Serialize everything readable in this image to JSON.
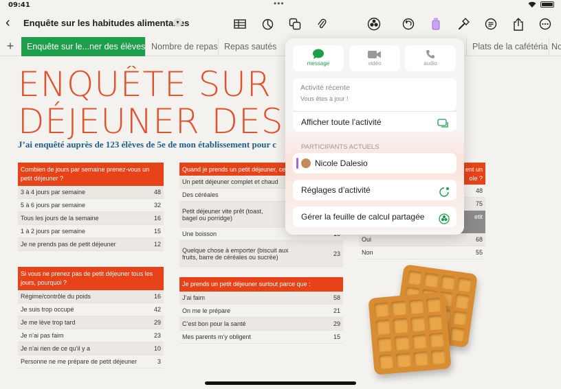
{
  "status": {
    "time": "09:41"
  },
  "toolbar": {
    "title": "Enquête sur les habitudes alimentaires"
  },
  "tabs": [
    "Enquête sur le...ner des élèves",
    "Nombre de repas",
    "Repas sautés",
    "Plats de la cafétéria",
    "No"
  ],
  "sheet": {
    "title_line1": "ENQUÊTE SUR LE",
    "title_line2": "DÉJEUNER DES ÉL",
    "subtitle": "J’ai enquêté auprès de 123 élèves de 5e de mon établissement pour c"
  },
  "tables": {
    "t1": {
      "header": "Combien de jours par semaine prenez-vous un petit déjeuner ?",
      "rows": [
        [
          "3 à 4 jours par semaine",
          "48"
        ],
        [
          "5 à 6 jours par semaine",
          "32"
        ],
        [
          "Tous les jours de la semaine",
          "16"
        ],
        [
          "1 à 2 jours par semaine",
          "15"
        ],
        [
          "Je ne prends pas de petit déjeuner",
          "12"
        ]
      ]
    },
    "t2": {
      "header": "Si vous ne prenez pas de petit déjeuner tous les jours, pourquoi ?",
      "rows": [
        [
          "Régime/contrôle du poids",
          "16"
        ],
        [
          "Je suis trop occupé",
          "42"
        ],
        [
          "Je me lève trop tard",
          "29"
        ],
        [
          "Je n’ai pas faim",
          "23"
        ],
        [
          "Je n’ai rien de ce qu’il y a",
          "10"
        ],
        [
          "Personne ne me prépare de petit déjeuner",
          "3"
        ]
      ]
    },
    "t3": {
      "header": "Quand je prends un petit déjeuner, ce que",
      "rows": [
        [
          "Un petit déjeuner complet et chaud",
          ""
        ],
        [
          "Des céréales",
          ""
        ],
        [
          "Petit déjeuner vite prêt (toast, bagel ou porridge)",
          ""
        ],
        [
          "Une boisson",
          "18"
        ],
        [
          "Quelque chose à emporter (biscuit aux fruits, barre de céréales ou sucrée)",
          "23"
        ]
      ]
    },
    "t4": {
      "header": "Je prends un petit déjeuner surtout parce que :",
      "rows": [
        [
          "J’ai faim",
          "58"
        ],
        [
          "On me le prépare",
          "21"
        ],
        [
          "C’est bon pour la santé",
          "29"
        ],
        [
          "Mes parents m’y obligent",
          "15"
        ]
      ]
    },
    "t5": {
      "header_a": "ent un",
      "header_b": "ole ?",
      "v1": "48",
      "v2": "75",
      "gray": "etit",
      "rows": [
        [
          "Oui",
          "68"
        ],
        [
          "Non",
          "55"
        ]
      ]
    }
  },
  "popover": {
    "message": "message",
    "video": "vidéo",
    "audio": "audio",
    "recent_label": "Activité récente",
    "recent_sub": "Vous êtes à jour !",
    "show_all": "Afficher toute l’activité",
    "participants_label": "PARTICIPANTS ACTUELS",
    "participant": "Nicole Dalesio",
    "settings": "Réglages d’activité",
    "manage": "Gérer la feuille de calcul partagée"
  },
  "colors": {
    "accent_green": "#1c9e4b",
    "title_orange": "#e0512c",
    "header_red": "#e84318"
  }
}
